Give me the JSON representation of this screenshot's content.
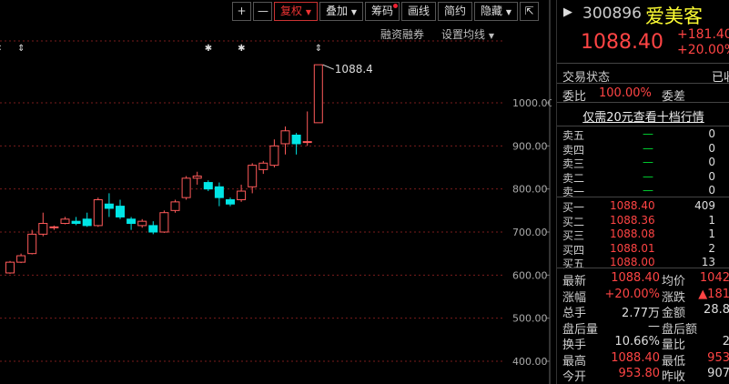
{
  "toolbar": {
    "plus": "+",
    "minus": "—",
    "fuquan": "复权",
    "diejia": "叠加",
    "chouma": "筹码",
    "huaxian": "画线",
    "jianyue": "简约",
    "yincang": "隐藏"
  },
  "subtoolbar": {
    "margin": "融资融券",
    "ma_settings": "设置均线"
  },
  "chart_data": {
    "type": "candlestick",
    "yticks": [
      "1000.00",
      "900.00",
      "800.00",
      "700.00",
      "600.00",
      "500.00",
      "400.00"
    ],
    "ylim": [
      380,
      1100
    ],
    "max_label": "1088.4",
    "candles": [
      {
        "o": 605,
        "c": 630,
        "h": 633,
        "l": 603
      },
      {
        "o": 630,
        "c": 645,
        "h": 650,
        "l": 628
      },
      {
        "o": 650,
        "c": 695,
        "h": 705,
        "l": 648
      },
      {
        "o": 695,
        "c": 720,
        "h": 745,
        "l": 690
      },
      {
        "o": 712,
        "c": 712,
        "h": 715,
        "l": 705
      },
      {
        "o": 720,
        "c": 730,
        "h": 735,
        "l": 718
      },
      {
        "o": 725,
        "c": 720,
        "h": 735,
        "l": 716
      },
      {
        "o": 730,
        "c": 715,
        "h": 745,
        "l": 712
      },
      {
        "o": 715,
        "c": 775,
        "h": 780,
        "l": 712
      },
      {
        "o": 765,
        "c": 755,
        "h": 790,
        "l": 735
      },
      {
        "o": 760,
        "c": 735,
        "h": 775,
        "l": 730
      },
      {
        "o": 730,
        "c": 720,
        "h": 735,
        "l": 705
      },
      {
        "o": 715,
        "c": 725,
        "h": 730,
        "l": 710
      },
      {
        "o": 715,
        "c": 700,
        "h": 725,
        "l": 695
      },
      {
        "o": 700,
        "c": 745,
        "h": 750,
        "l": 698
      },
      {
        "o": 750,
        "c": 770,
        "h": 775,
        "l": 745
      },
      {
        "o": 780,
        "c": 825,
        "h": 830,
        "l": 775
      },
      {
        "o": 825,
        "c": 830,
        "h": 840,
        "l": 810
      },
      {
        "o": 815,
        "c": 800,
        "h": 820,
        "l": 795
      },
      {
        "o": 805,
        "c": 780,
        "h": 815,
        "l": 760
      },
      {
        "o": 775,
        "c": 765,
        "h": 780,
        "l": 760
      },
      {
        "o": 775,
        "c": 795,
        "h": 810,
        "l": 770
      },
      {
        "o": 805,
        "c": 855,
        "h": 860,
        "l": 790
      },
      {
        "o": 845,
        "c": 860,
        "h": 865,
        "l": 835
      },
      {
        "o": 855,
        "c": 900,
        "h": 915,
        "l": 850
      },
      {
        "o": 905,
        "c": 935,
        "h": 945,
        "l": 880
      },
      {
        "o": 925,
        "c": 905,
        "h": 930,
        "l": 880
      },
      {
        "o": 910,
        "c": 910,
        "h": 980,
        "l": 900
      },
      {
        "o": 953.8,
        "c": 1088.4,
        "h": 1088.4,
        "l": 953.8
      }
    ],
    "event_markers": [
      {
        "index": -1,
        "glyph": "⇕"
      },
      {
        "index": 1,
        "glyph": "⇕"
      },
      {
        "index": 18,
        "glyph": "✱"
      },
      {
        "index": 21,
        "glyph": "✱"
      },
      {
        "index": 28,
        "glyph": "⇕"
      }
    ],
    "colors": {
      "up": "#ff5a5a",
      "down": "#00e5e5",
      "grid": "#7a1c1c",
      "axis": "#aaaaaa"
    }
  },
  "stock": {
    "code": "300896",
    "name": "爱美客",
    "price": "1088.40",
    "change": "+181.40",
    "change_pct": "+20.00%"
  },
  "panel": {
    "status_label": "交易状态",
    "status_value": "已收",
    "weibi_label": "委比",
    "weibi_value": "100.00%",
    "weicha_label": "委差",
    "promo": "仅需20元查看十档行情",
    "sells": [
      {
        "label": "卖五",
        "price": "—",
        "vol": "0"
      },
      {
        "label": "卖四",
        "price": "—",
        "vol": "0"
      },
      {
        "label": "卖三",
        "price": "—",
        "vol": "0"
      },
      {
        "label": "卖二",
        "price": "—",
        "vol": "0"
      },
      {
        "label": "卖一",
        "price": "—",
        "vol": "0"
      }
    ],
    "buys": [
      {
        "label": "买一",
        "price": "1088.40",
        "vol": "409"
      },
      {
        "label": "买二",
        "price": "1088.36",
        "vol": "1"
      },
      {
        "label": "买三",
        "price": "1088.08",
        "vol": "1"
      },
      {
        "label": "买四",
        "price": "1088.01",
        "vol": "2"
      },
      {
        "label": "买五",
        "price": "1088.00",
        "vol": "13"
      }
    ],
    "stats": [
      {
        "l1": "最新",
        "v1": "1088.40",
        "c1": "red",
        "l2": "均价",
        "v2": "1042",
        "c2": "red"
      },
      {
        "l1": "涨幅",
        "v1": "+20.00%",
        "c1": "red",
        "l2": "涨跌",
        "v2": "▲181",
        "c2": "red"
      },
      {
        "l1": "总手",
        "v1": "2.77万",
        "c1": "white",
        "l2": "金额",
        "v2": "28.8",
        "c2": "white"
      },
      {
        "l1": "盘后量",
        "v1": "—",
        "c1": "white",
        "l2": "盘后额",
        "v2": "",
        "c2": "white"
      },
      {
        "l1": "换手",
        "v1": "10.66%",
        "c1": "white",
        "l2": "量比",
        "v2": "2",
        "c2": "white"
      },
      {
        "l1": "最高",
        "v1": "1088.40",
        "c1": "red",
        "l2": "最低",
        "v2": "953",
        "c2": "red"
      },
      {
        "l1": "今开",
        "v1": "953.80",
        "c1": "red",
        "l2": "昨收",
        "v2": "907",
        "c2": "white"
      }
    ]
  }
}
